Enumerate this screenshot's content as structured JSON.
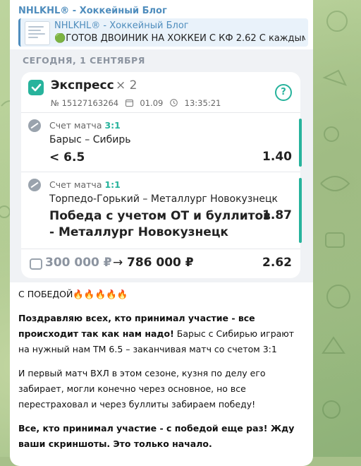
{
  "channel": {
    "title": "NHLKHL® - Хоккейный Блог"
  },
  "reply": {
    "author": "NHLKHL® - Хоккейный Блог",
    "emoji": "🟢",
    "preview": "ГОТОВ ДВОЙНИК НА ХОККЕЙ С КФ 2.62  С каждым д..."
  },
  "screenshot": {
    "date_label": "СЕГОДНЯ, 1 СЕНТЯБРЯ",
    "bet": {
      "type": "Экспресс",
      "multiplier": "× 2",
      "number": "№ 15127163264",
      "date": "01.09",
      "time": "13:35:21",
      "help_icon": "?"
    },
    "legs": [
      {
        "label": "Счет матча",
        "score": "3:1",
        "match": "Барыс – Сибирь",
        "pick": "< 6.5",
        "odd": "1.40"
      },
      {
        "label": "Счет матча",
        "score": "1:1",
        "match": "Торпедо-Горький – Металлург Новокузнецк",
        "pick_line1": "Победа с учетом ОТ и буллитов",
        "pick_line2": "- Металлург Новокузнецк",
        "odd": "1.87"
      }
    ],
    "footer": {
      "stake": "300 000 ₽",
      "arrow": "→",
      "win": "786 000 ₽",
      "total_odd": "2.62"
    }
  },
  "post": {
    "headline": "С ПОБЕДОЙ🔥🔥🔥🔥🔥",
    "p1_bold": "Поздравляю всех, кто принимал участие - все происходит так как нам надо!",
    "p1_rest": " Барыс с Сибирью играют на нужный нам ТМ 6.5 – заканчивая матч со счетом 3:1",
    "p2": "И первый матч ВХЛ в этом сезоне, кузня по делу его забирает, могли конечно через основное, но все перестраховал и через буллиты забираем победу!",
    "p3": "Все, кто принимал участие - с победой еще раз! Жду ваши скриншоты. Это только начало."
  },
  "colors": {
    "accent_green": "#27b39c",
    "link_blue": "#4f8dbd",
    "wallpaper": "#a7c08a"
  }
}
